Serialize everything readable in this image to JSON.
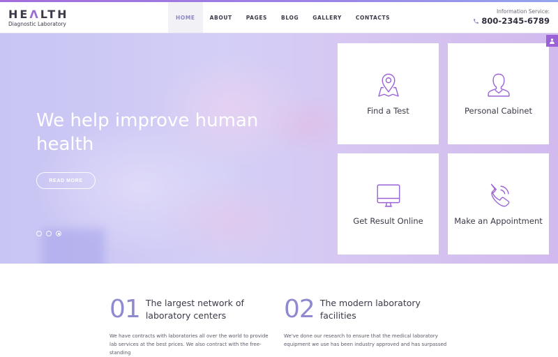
{
  "brand": {
    "title_part1": "HE",
    "title_accent": "Λ",
    "title_part2": "LTH",
    "subtitle": "Diagnostic Laboratory"
  },
  "nav": {
    "items": [
      {
        "label": "HOME",
        "active": true
      },
      {
        "label": "ABOUT",
        "active": false
      },
      {
        "label": "PAGES",
        "active": false
      },
      {
        "label": "BLOG",
        "active": false
      },
      {
        "label": "GALLERY",
        "active": false
      },
      {
        "label": "CONTACTS",
        "active": false
      }
    ]
  },
  "info": {
    "label": "Information Service:",
    "phone": "800-2345-6789",
    "phone_icon": "phone-icon"
  },
  "hero": {
    "title": "We help improve human health",
    "button_label": "READ MORE",
    "slides": 3,
    "active_slide": 3
  },
  "tiles": [
    {
      "label": "Find a Test",
      "icon": "map-pin-icon"
    },
    {
      "label": "Personal Cabinet",
      "icon": "user-icon"
    },
    {
      "label": "Get Result Online",
      "icon": "monitor-icon"
    },
    {
      "label": "Make an Appointment",
      "icon": "phone-call-icon"
    }
  ],
  "user_tab_icon": "user-icon",
  "features": [
    {
      "number": "01",
      "title": "The largest network of laboratory centers",
      "text": "We have contracts with laboratories all over the world to provide lab services at the best prices. We also contract with the free-standing"
    },
    {
      "number": "02",
      "title": "The modern laboratory facilities",
      "text": "We've done our research to ensure that the medical laboratory equipment we use has been industry approved and has surpassed"
    }
  ],
  "colors": {
    "accent": "#9a62d6",
    "nav_active": "#8b86c4",
    "number": "#8f89d0",
    "text_dark": "#3a3a48"
  }
}
